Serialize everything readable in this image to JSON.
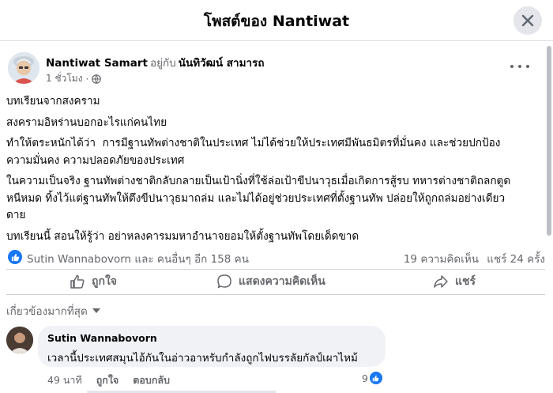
{
  "dialog": {
    "title": "โพสต์ของ Nantiwat",
    "close_icon": "close-icon"
  },
  "post": {
    "author": "Nantiwat Samart",
    "with_text": "อยู่กับ",
    "tagged": "นันทิวัฒน์ สามารถ",
    "time": "1 ชั่วโมง",
    "privacy_icon": "globe-icon",
    "more_icon": "more-dots-icon",
    "paragraphs": [
      "บทเรียนจากสงคราม",
      "สงครามอิหร่านบอกอะไรแก่คนไทย",
      "ทำให้ตระหนักได้ว่า  การมีฐานทัพต่างชาติในประเทศ ไม่ได้ช่วยให้ประเทศมีพันธมิตรที่มั่นคง และช่วยปกป้อง\nความมั่นคง ความปลอดภัยของประเทศ",
      "ในความเป็นจริง ฐานทัพต่างชาติกลับกลายเป็นเป้านิ่งที่ใช้ล่อเป้าขีปนาวุธเมื่อเกิดการสู้รบ ทหารต่างชาติถลกตูด\nหนีหมด ทิ้งไว้แต่ฐานทัพให้ตึงขีปนาวุธมาถล่ม และไม่ได้อยู่ช่วยประเทศที่ตั้งฐานทัพ ปล่อยให้ถูกถล่มอย่างเดียว\nดาย",
      "บทเรียนนี้ สอนให้รู้ว่า อย่าหลงคารมมหาอำนาจยอมให้ตั้งฐานทัพโดยเด็ดขาด"
    ]
  },
  "stats": {
    "reactors": "Sutin Wannabovorn และ คนอื่นๆ อีก 158 คน",
    "comments": "19 ความคิดเห็น",
    "shares": "แชร์ 24 ครั้ง"
  },
  "actions": {
    "like": "ถูกใจ",
    "comment": "แสดงความคิดเห็น",
    "share": "แชร์"
  },
  "comments_filter": "เกี่ยวข้องมากที่สุด",
  "comment": {
    "author": "Sutin Wannabovorn",
    "text": "เวลานี้ประเทศสมุนไอ้กันในอ่าวอาหรับกำลังถูกไฟบรรลัยกัลป์เผาไหม้",
    "time": "49 นาที",
    "like": "ถูกใจ",
    "reply": "ตอบกลับ",
    "reaction_count": "9"
  },
  "colors": {
    "accent": "#1877f2",
    "secondary_text": "#65676b",
    "bubble": "#f0f2f5"
  }
}
